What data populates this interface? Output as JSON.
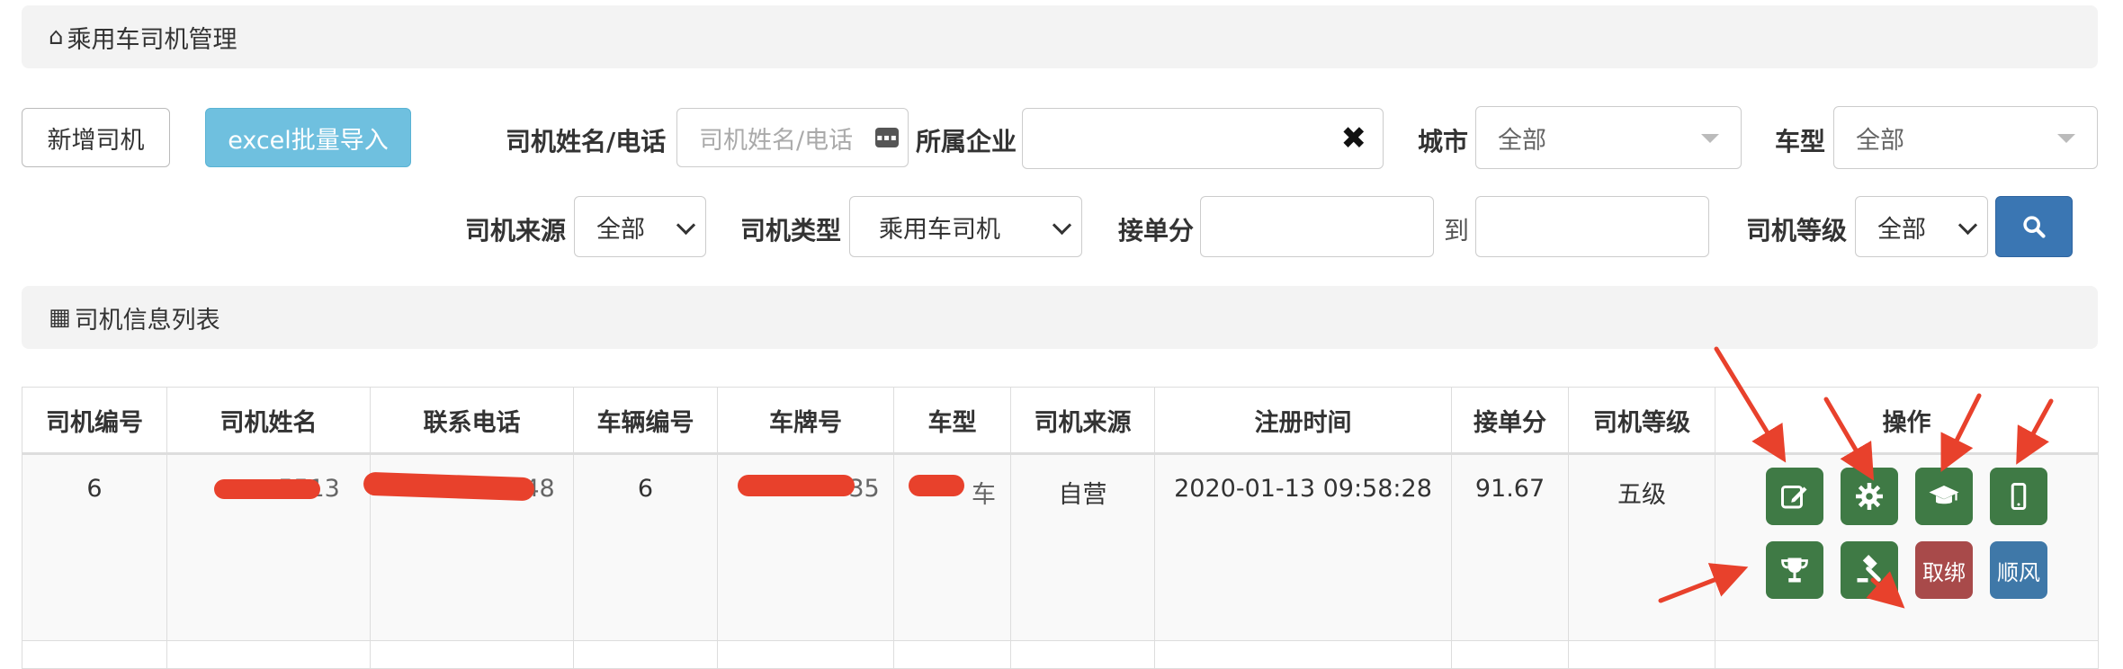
{
  "breadcrumb": {
    "title": "乘用车司机管理",
    "icon": "home-icon"
  },
  "toolbar": {
    "add_driver": "新增司机",
    "excel_import": "excel批量导入"
  },
  "filters": {
    "name_phone_label": "司机姓名/电话",
    "name_phone_placeholder": "司机姓名/电话",
    "company_label": "所属企业",
    "company_value": "",
    "city_label": "城市",
    "city_value": "全部",
    "car_type_label": "车型",
    "car_type_value": "全部",
    "source_label": "司机来源",
    "source_value": "全部",
    "driver_type_label": "司机类型",
    "driver_type_value": "乘用车司机",
    "score_label": "接单分",
    "score_from": "",
    "score_to_label": "到",
    "score_to": "",
    "level_label": "司机等级",
    "level_value": "全部"
  },
  "list_header": {
    "title": "司机信息列表",
    "icon": "table-icon"
  },
  "table": {
    "columns": [
      "司机编号",
      "司机姓名",
      "联系电话",
      "车辆编号",
      "车牌号",
      "车型",
      "司机来源",
      "注册时间",
      "接单分",
      "司机等级",
      "操作"
    ],
    "rows": [
      {
        "driver_id": "6",
        "driver_name": "5513",
        "phone": "48",
        "vehicle_id": "6",
        "plate": "35",
        "car_type": "车",
        "source": "自营",
        "register_time": "2020-01-13 09:58:28",
        "score": "91.67",
        "level": "五级",
        "actions": {
          "unbind": "取绑",
          "carpool": "顺风"
        }
      }
    ]
  },
  "colors": {
    "action_green": "#3f7a45",
    "action_red": "#a84a4a",
    "action_blue": "#3f78a8",
    "primary": "#3a76b3",
    "info": "#6fc0df",
    "annotation_red": "#e8412c"
  }
}
